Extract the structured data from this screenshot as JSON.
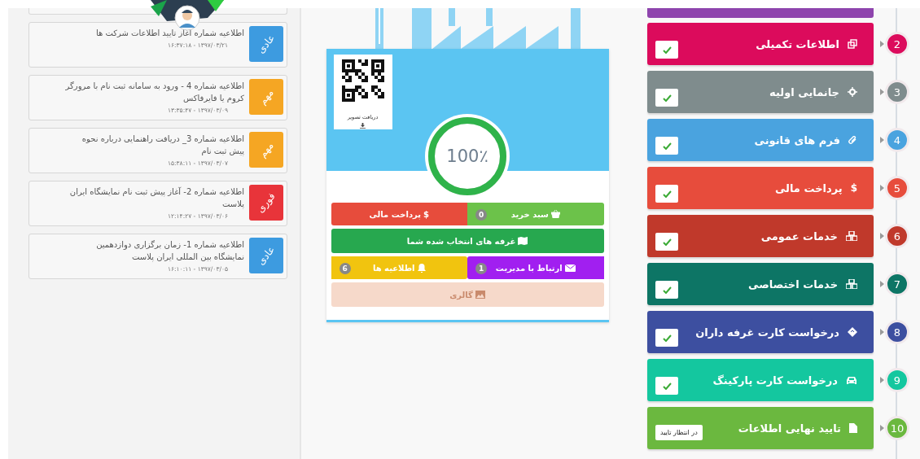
{
  "notices": [
    {
      "title": "اطلاعیه شماره   آغاز تایید اطلاعات شرکت ها",
      "date": "۱۳۹۷/۰۳/۲۱ - ۱۶:۳۷:۱۸",
      "tag": "عادی",
      "color": "#3d9be0"
    },
    {
      "title": "اطلاعیه شماره 4 - ورود به سامانه ثبت نام با مرورگر کروم یا فایرفاکس",
      "date": "۱۳۹۷/۰۳/۰۹ - ۱۳:۳۵:۴۷",
      "tag": "مهم",
      "color": "#f5a623"
    },
    {
      "title": "اطلاعیه شماره 3_ دریافت راهنمایی درباره نحوه پیش ثبت نام",
      "date": "۱۳۹۷/۰۳/۰۷ - ۱۵:۳۸:۱۱",
      "tag": "مهم",
      "color": "#f5a623"
    },
    {
      "title": "اطلاعیه شماره 2- آغاز پیش ثبت نام نمایشگاه ایران پلاست",
      "date": "۱۳۹۷/۰۳/۰۶ - ۱۲:۱۴:۲۷",
      "tag": "فوری",
      "color": "#e8343a"
    },
    {
      "title": "اطلاعیه شماره 1- زمان برگزاری دوازدهمین نمایشگاه بین المللی ایران پلاست",
      "date": "۱۳۹۷/۰۳/۰۵ - ۱۶:۱۰:۱۱",
      "tag": "عادی",
      "color": "#3d9be0"
    }
  ],
  "profile": {
    "qr_caption": "دریافت تصویر",
    "progress": {
      "level": 1,
      "text": "100٪"
    }
  },
  "actions": [
    {
      "label": "سبد خرید",
      "badge": "0",
      "color": "#6cc24a",
      "kind": "half",
      "disabled": false
    },
    {
      "label": "پرداخت مالی",
      "glyph": "$",
      "color": "#e74c3c",
      "kind": "half",
      "disabled": false
    },
    {
      "label": "غرفه های انتخاب شده شما",
      "color": "#27a84f",
      "kind": "full",
      "disabled": false
    },
    {
      "label": "ارتباط با مدیریت",
      "badge": "1",
      "color": "#a11ff0",
      "kind": "half",
      "disabled": false
    },
    {
      "label": "اطلاعیه ها",
      "badge": "6",
      "color": "#f1c40f",
      "kind": "half",
      "disabled": false
    },
    {
      "label": "گالری",
      "color": "#f6d9ca",
      "kind": "full",
      "disabled": true
    }
  ],
  "steps": [
    {
      "number": "2",
      "label": "اطلاعات تکمیلی",
      "color": "#dc0b5c",
      "done": true
    },
    {
      "number": "3",
      "label": "جانمایی اولیه",
      "color": "#7f8c8d",
      "done": true
    },
    {
      "number": "4",
      "label": "فرم های قانونی",
      "color": "#4aa3df",
      "done": true
    },
    {
      "number": "5",
      "label": "پرداخت مالی",
      "glyph": "$",
      "color": "#e74c3c",
      "done": true
    },
    {
      "number": "6",
      "label": "خدمات عمومی",
      "color": "#c0392b",
      "done": true
    },
    {
      "number": "7",
      "label": "خدمات اختصاصی",
      "color": "#0d7565",
      "done": true
    },
    {
      "number": "8",
      "label": "درخواست کارت غرفه داران",
      "color": "#3d4fa0",
      "done": true
    },
    {
      "number": "9",
      "label": "درخواست کارت پارکینگ",
      "color": "#14c79f",
      "done": true
    },
    {
      "number": "10",
      "label": "تایید نهایی اطلاعات",
      "color": "#6bb83f",
      "done": false,
      "status": "در انتظار تایید"
    }
  ]
}
